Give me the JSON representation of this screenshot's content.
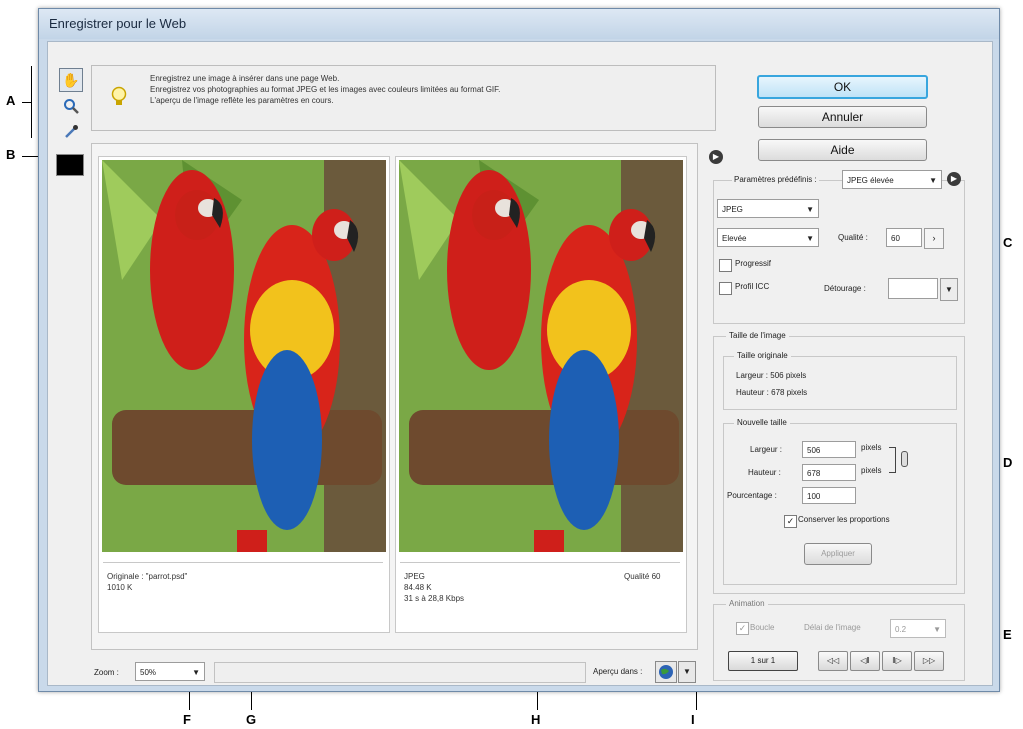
{
  "window": {
    "title": "Enregistrer pour le Web"
  },
  "info": {
    "line1": "Enregistrez une image à insérer dans une page Web.",
    "line2": "Enregistrez vos photographies au format JPEG et les images avec couleurs limitées au format GIF.",
    "line3": "L'aperçu de l'image reflète les paramètres en cours."
  },
  "buttons": {
    "ok": "OK",
    "cancel": "Annuler",
    "help": "Aide",
    "apply": "Appliquer"
  },
  "original": {
    "name": "Originale : \"parrot.psd\"",
    "size": "1010 K"
  },
  "optimized": {
    "format": "JPEG",
    "size": "84.48 K",
    "time": "31 s à 28,8 Kbps",
    "quality": "Qualité 60"
  },
  "settings": {
    "preset_label": "Paramètres prédéfinis :",
    "preset_value": "JPEG élevée",
    "format": "JPEG",
    "compression": "Elevée",
    "quality_label": "Qualité :",
    "quality_value": "60",
    "progressive": "Progressif",
    "icc": "Profil ICC",
    "matte_label": "Détourage :"
  },
  "image_size": {
    "title": "Taille de l'image",
    "original_title": "Taille originale",
    "orig_width": "Largeur : 506 pixels",
    "orig_height": "Hauteur : 678 pixels",
    "new_title": "Nouvelle taille",
    "width_label": "Largeur :",
    "width_value": "506",
    "height_label": "Hauteur :",
    "height_value": "678",
    "unit": "pixels",
    "percent_label": "Pourcentage :",
    "percent_value": "100",
    "constrain": "Conserver les proportions"
  },
  "animation": {
    "title": "Animation",
    "loop": "Boucle",
    "delay_label": "Délai de l'image",
    "delay_value": "0.2",
    "frame": "1 sur 1",
    "nav": [
      "◁◁",
      "◁‖",
      "‖▷",
      "▷▷"
    ]
  },
  "footer": {
    "zoom_label": "Zoom :",
    "zoom_value": "50%",
    "preview_label": "Aperçu dans :"
  },
  "callouts": [
    "A",
    "B",
    "C",
    "D",
    "E",
    "F",
    "G",
    "H",
    "I"
  ],
  "colors": {
    "accent": "#38a6de",
    "frame": "#c9d9ea",
    "panel": "#f0f0f0"
  }
}
